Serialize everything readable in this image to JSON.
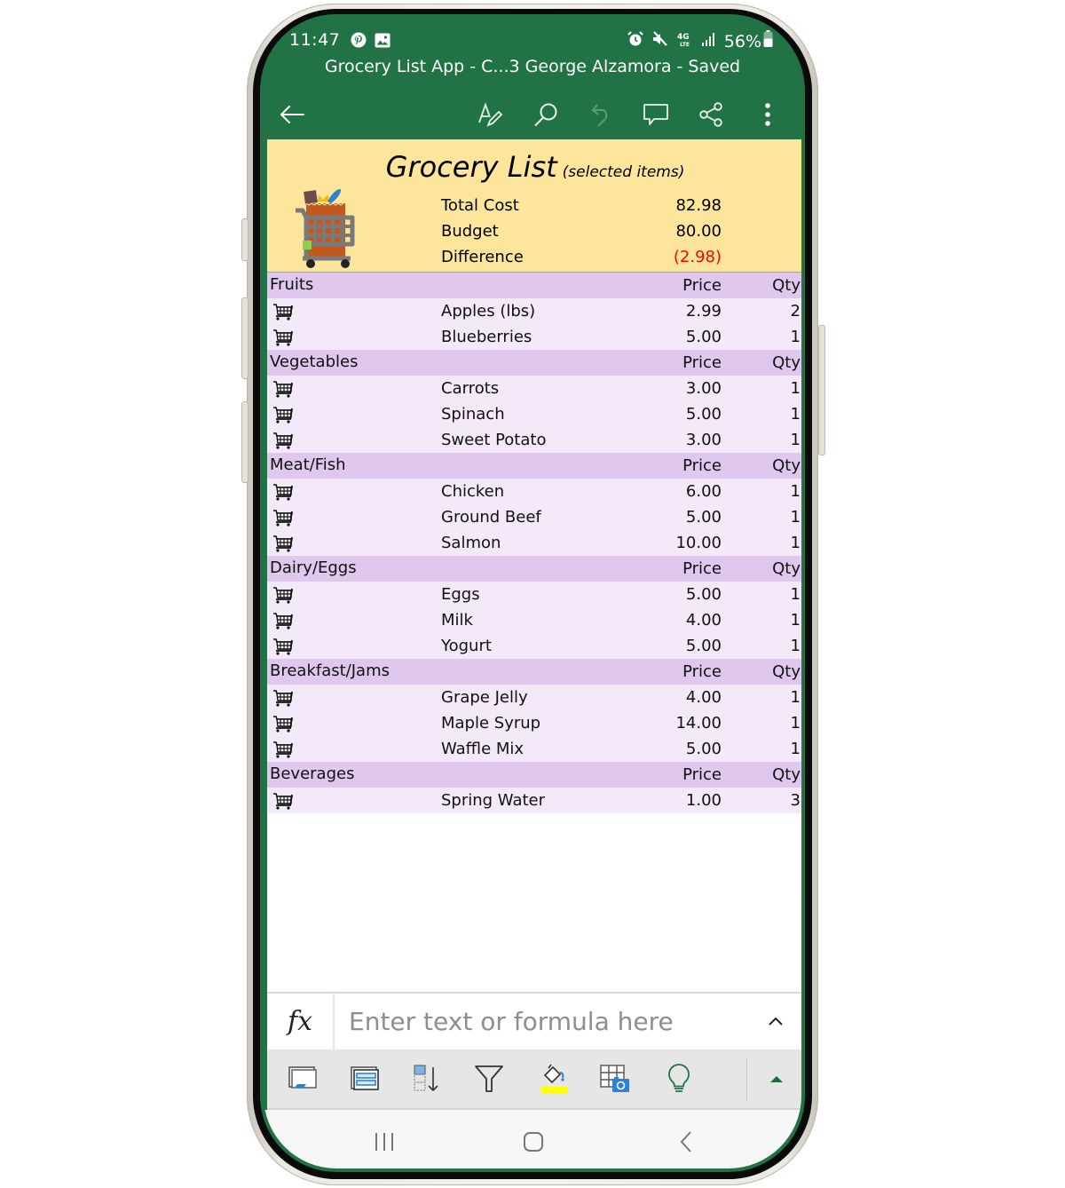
{
  "status_bar": {
    "time": "11:47",
    "left_icons": [
      "pinterest-icon",
      "gallery-icon"
    ],
    "right_icons": [
      "alarm-icon",
      "mute-icon",
      "4g-lte-icon",
      "signal-icon"
    ],
    "battery": "56%"
  },
  "document": {
    "title": "Grocery List App - C...3 George Alzamora  - Saved"
  },
  "toolbar": {
    "back": "back-arrow-icon",
    "actions": [
      "draw-icon",
      "search-icon",
      "undo-icon",
      "comment-icon",
      "share-icon",
      "more-icon"
    ]
  },
  "sheet": {
    "title": "Grocery List",
    "subtitle": "(selected items)",
    "summary": [
      {
        "label": "Total Cost",
        "value": "82.98"
      },
      {
        "label": "Budget",
        "value": "80.00"
      },
      {
        "label": "Difference",
        "value": "(2.98)"
      }
    ],
    "price_header": "Price",
    "qty_header": "Qty",
    "categories": [
      {
        "name": "Fruits",
        "items": [
          {
            "name": "Apples (lbs)",
            "price": "2.99",
            "qty": "2"
          },
          {
            "name": "Blueberries",
            "price": "5.00",
            "qty": "1"
          }
        ]
      },
      {
        "name": "Vegetables",
        "items": [
          {
            "name": "Carrots",
            "price": "3.00",
            "qty": "1"
          },
          {
            "name": "Spinach",
            "price": "5.00",
            "qty": "1"
          },
          {
            "name": "Sweet Potato",
            "price": "3.00",
            "qty": "1"
          }
        ]
      },
      {
        "name": "Meat/Fish",
        "items": [
          {
            "name": "Chicken",
            "price": "6.00",
            "qty": "1"
          },
          {
            "name": "Ground Beef",
            "price": "5.00",
            "qty": "1"
          },
          {
            "name": "Salmon",
            "price": "10.00",
            "qty": "1"
          }
        ]
      },
      {
        "name": "Dairy/Eggs",
        "items": [
          {
            "name": "Eggs",
            "price": "5.00",
            "qty": "1"
          },
          {
            "name": "Milk",
            "price": "4.00",
            "qty": "1"
          },
          {
            "name": "Yogurt",
            "price": "5.00",
            "qty": "1"
          }
        ]
      },
      {
        "name": "Breakfast/Jams",
        "items": [
          {
            "name": "Grape Jelly",
            "price": "4.00",
            "qty": "1"
          },
          {
            "name": "Maple Syrup",
            "price": "14.00",
            "qty": "1"
          },
          {
            "name": "Waffle Mix",
            "price": "5.00",
            "qty": "1"
          }
        ]
      },
      {
        "name": "Beverages",
        "items": [
          {
            "name": "Spring Water",
            "price": "1.00",
            "qty": "3"
          }
        ]
      }
    ]
  },
  "formula_bar": {
    "fx_label": "fx",
    "value": "",
    "placeholder": "Enter text or formula here"
  },
  "command_bar": {
    "items": [
      "freeze-panes-icon",
      "wrap-text-icon",
      "sort-icon",
      "filter-icon",
      "fill-color-icon",
      "insert-picture-table-icon",
      "ideas-icon"
    ],
    "expand": "expand-triangle-icon"
  },
  "nav_bar": {
    "items": [
      "recents-icon",
      "home-icon",
      "back-icon"
    ]
  },
  "colors": {
    "app_green": "#217346",
    "header_yellow": "#fde69c",
    "category_purple": "#dfc7ed",
    "item_lavender": "#f3e9f8",
    "negative_red": "#ff0000",
    "fill_yellow": "#ffff00"
  }
}
